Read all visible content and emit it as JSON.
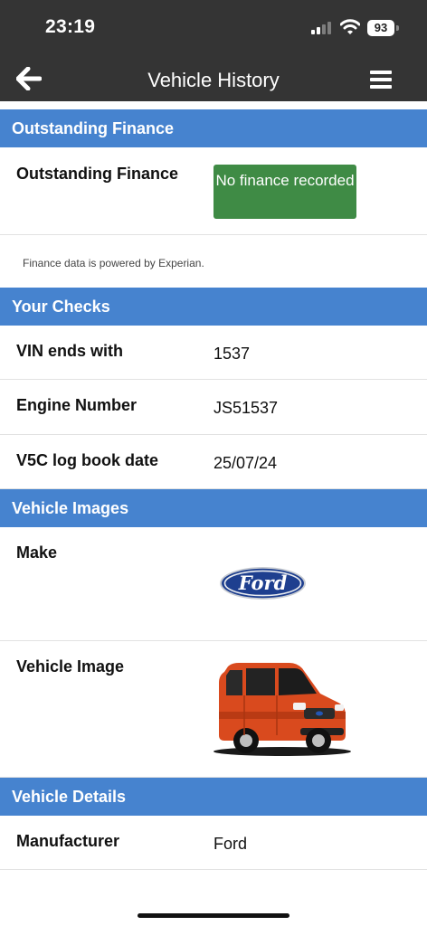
{
  "status_bar": {
    "time": "23:19",
    "battery": "93"
  },
  "nav": {
    "title": "Vehicle History",
    "back_icon": "arrow-left-icon",
    "menu_icon": "hamburger-menu-icon"
  },
  "sections": {
    "finance": {
      "header": "Outstanding Finance",
      "label": "Outstanding Finance",
      "badge": "No finance recorded",
      "badge_color": "#3f8b45",
      "note": "Finance data is powered by Experian."
    },
    "checks": {
      "header": "Your Checks",
      "rows": [
        {
          "label": "VIN ends with",
          "value": "1537"
        },
        {
          "label": "Engine Number",
          "value": "JS51537"
        },
        {
          "label": "V5C log book date",
          "value": "25/07/24"
        }
      ]
    },
    "images": {
      "header": "Vehicle Images",
      "make_label": "Make",
      "make_logo_text": "Ford",
      "vehicle_image_label": "Vehicle Image"
    },
    "details": {
      "header": "Vehicle Details",
      "rows": [
        {
          "label": "Manufacturer",
          "value": "Ford"
        }
      ]
    }
  },
  "colors": {
    "header_bar": "#343434",
    "section_header": "#4683cf",
    "finance_badge": "#3f8b45",
    "van_body": "#d94a1e"
  }
}
